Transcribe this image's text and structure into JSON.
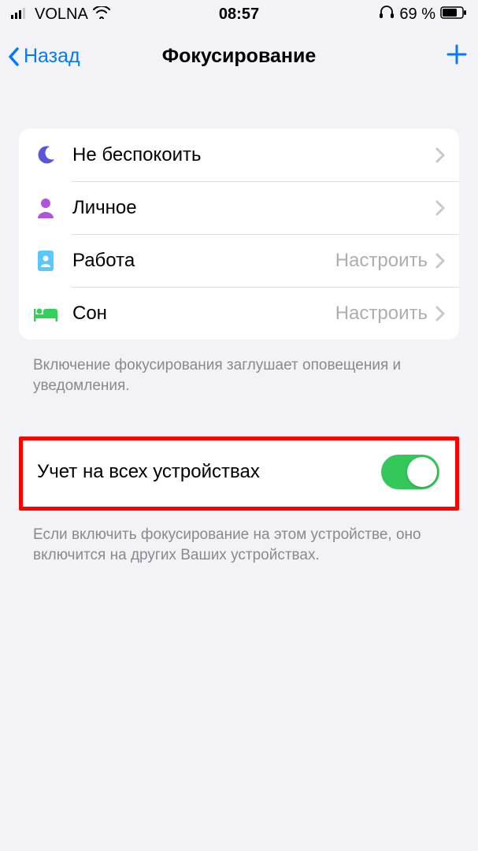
{
  "status": {
    "carrier": "VOLNA",
    "time": "08:57",
    "battery": "69 %"
  },
  "nav": {
    "back": "Назад",
    "title": "Фокусирование"
  },
  "focus_modes": [
    {
      "label": "Не беспокоить",
      "detail": ""
    },
    {
      "label": "Личное",
      "detail": ""
    },
    {
      "label": "Работа",
      "detail": "Настроить"
    },
    {
      "label": "Сон",
      "detail": "Настроить"
    }
  ],
  "footer1": "Включение фокусирования заглушает оповещения и уведомления.",
  "toggle": {
    "label": "Учет на всех устройствах",
    "on": true
  },
  "footer2": "Если включить фокусирование на этом устройстве, оно включится на других Ваших устройствах."
}
